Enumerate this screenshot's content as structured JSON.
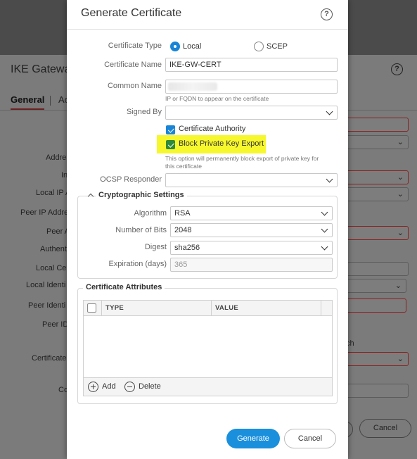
{
  "background": {
    "title": "IKE Gatewa",
    "tabs": [
      {
        "label": "General"
      },
      {
        "label": "Ac"
      }
    ],
    "labels": [
      "Addre",
      "In",
      "Local IP A",
      "Peer IP Addre",
      "Peer A",
      "Authent",
      "Local Cer",
      "Local Identi",
      "Peer Identi",
      "Peer ID",
      "Certificate",
      "Co"
    ],
    "partial_text": "ch",
    "cancel_label": "Cancel"
  },
  "dialog": {
    "title": "Generate Certificate",
    "certificate_type": {
      "label": "Certificate Type",
      "options": [
        {
          "label": "Local",
          "selected": true
        },
        {
          "label": "SCEP",
          "selected": false
        }
      ]
    },
    "certificate_name": {
      "label": "Certificate Name",
      "value": "IKE-GW-CERT"
    },
    "common_name": {
      "label": "Common Name",
      "value": "",
      "hint": "IP or FQDN to appear on the certificate"
    },
    "signed_by": {
      "label": "Signed By",
      "value": ""
    },
    "certificate_authority": {
      "label": "Certificate Authority",
      "checked": true
    },
    "block_private_key": {
      "label": "Block Private Key Export",
      "checked": true,
      "hint_line1": "This option will permanently block export of private key for",
      "hint_line2": "this certificate"
    },
    "ocsp_responder": {
      "label": "OCSP Responder",
      "value": ""
    },
    "crypto": {
      "legend": "Cryptographic Settings",
      "algorithm": {
        "label": "Algorithm",
        "value": "RSA"
      },
      "number_of_bits": {
        "label": "Number of Bits",
        "value": "2048"
      },
      "digest": {
        "label": "Digest",
        "value": "sha256"
      },
      "expiration": {
        "label": "Expiration (days)",
        "placeholder": "365"
      }
    },
    "attributes": {
      "legend": "Certificate Attributes",
      "columns": [
        "TYPE",
        "VALUE"
      ],
      "rows": [],
      "add_label": "Add",
      "delete_label": "Delete"
    },
    "generate_label": "Generate",
    "cancel_label": "Cancel"
  },
  "colors": {
    "accent": "#1a8fdc",
    "highlight": "#f7f72d",
    "check_green": "#2f8a3a"
  }
}
